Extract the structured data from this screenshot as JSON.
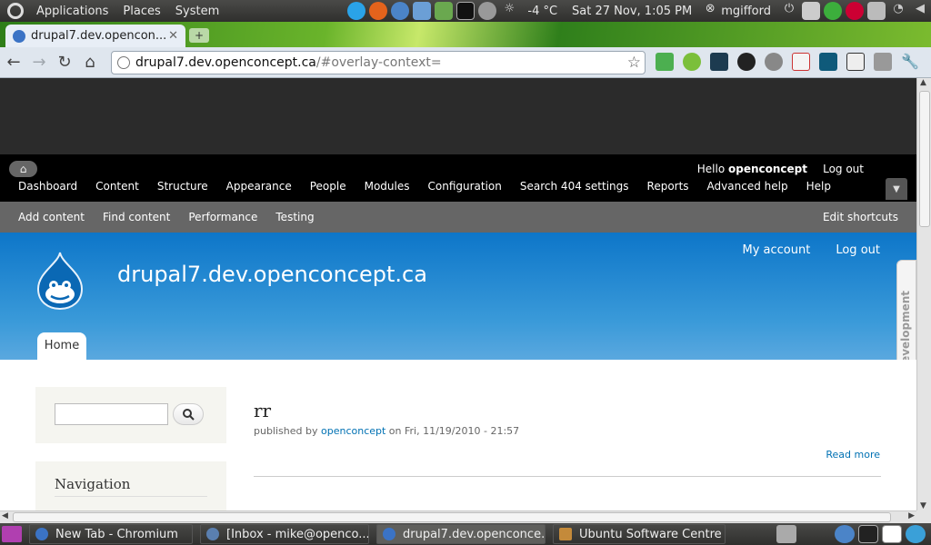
{
  "top_panel": {
    "menus": [
      "Applications",
      "Places",
      "System"
    ],
    "temperature": "-4 °C",
    "datetime": "Sat 27 Nov,  1:05 PM",
    "user": "mgifford"
  },
  "browser": {
    "tab_title": "drupal7.dev.opencon...",
    "url_host": "drupal7.dev.openconcept.ca",
    "url_path": "/#overlay-context="
  },
  "admin_toolbar": {
    "hello_prefix": "Hello ",
    "username": "openconcept",
    "logout": "Log out",
    "menu": [
      "Dashboard",
      "Content",
      "Structure",
      "Appearance",
      "People",
      "Modules",
      "Configuration",
      "Search 404 settings",
      "Reports",
      "Advanced help",
      "Help"
    ]
  },
  "shortcuts": {
    "items": [
      "Add content",
      "Find content",
      "Performance",
      "Testing"
    ],
    "edit": "Edit shortcuts"
  },
  "site": {
    "name": "drupal7.dev.openconcept.ca",
    "my_account": "My account",
    "logout": "Log out",
    "home_tab": "Home",
    "under_development": "Under Development"
  },
  "sidebar": {
    "navigation_title": "Navigation"
  },
  "node": {
    "title": "rr",
    "meta_prefix": "published by ",
    "author": "openconcept",
    "meta_date": " on Fri, 11/19/2010 - 21:57",
    "read_more": "Read more"
  },
  "taskbar": {
    "tasks": [
      "New Tab - Chromium",
      "[Inbox - mike@openco...",
      "drupal7.dev.openconce...",
      "Ubuntu Software Centre"
    ]
  },
  "colors": {
    "drupal_blue": "#0d76c9",
    "link_blue": "#0071b3",
    "admin_bar": "#000000"
  }
}
